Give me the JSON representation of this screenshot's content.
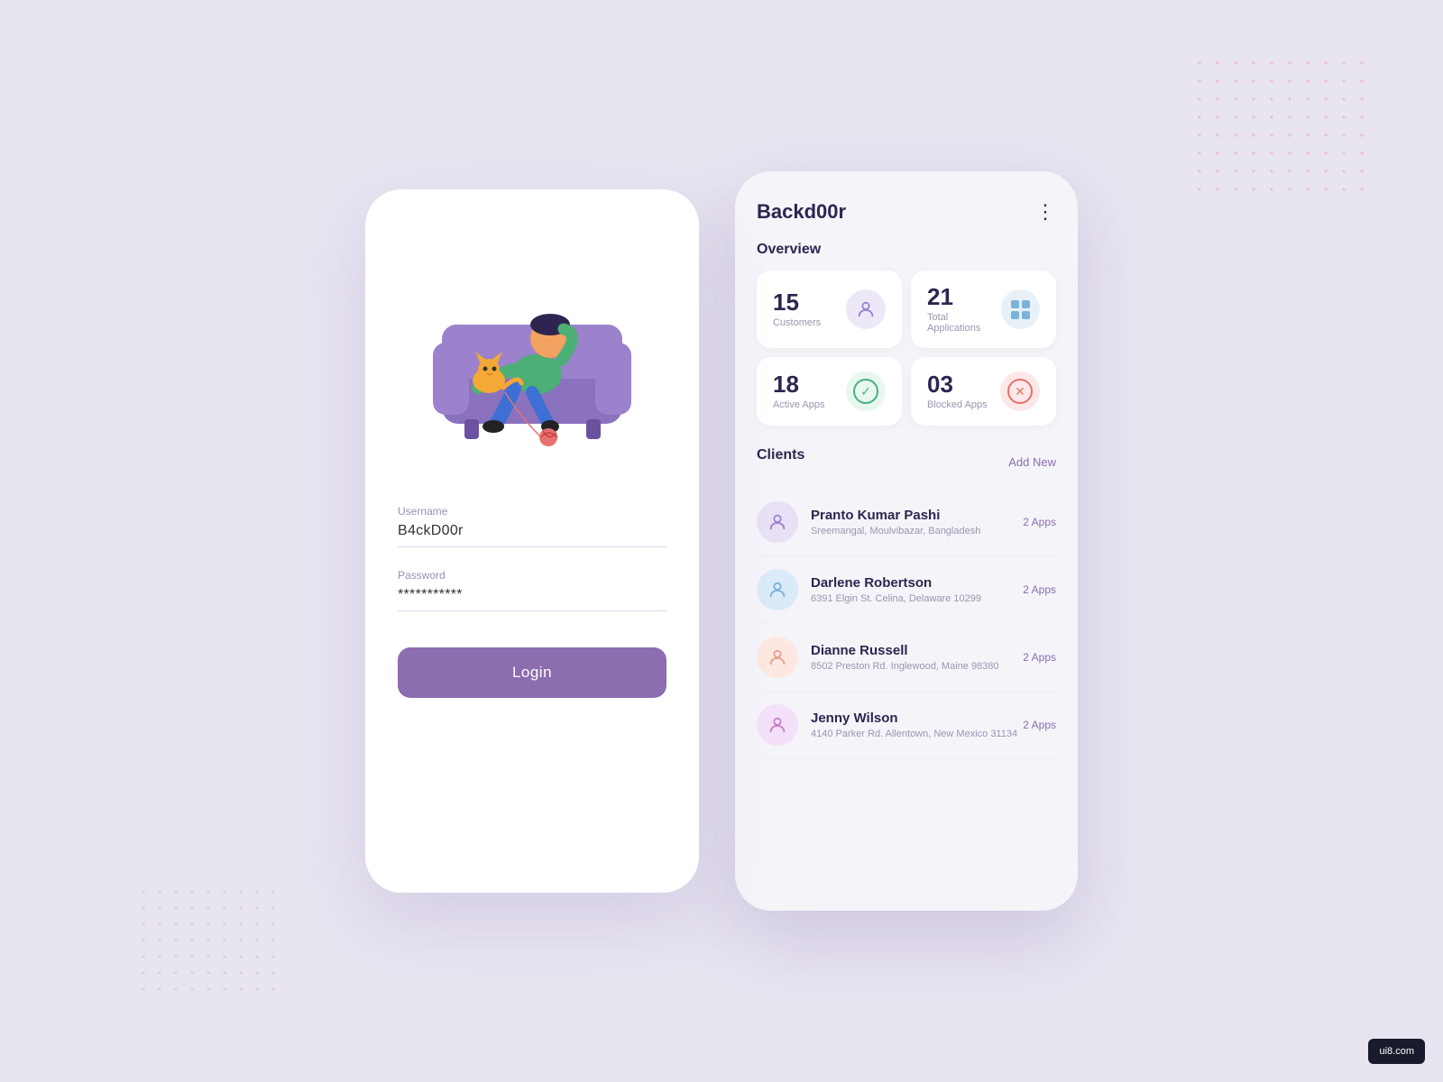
{
  "background": {
    "color": "#e8e4f0"
  },
  "login_screen": {
    "username_label": "Username",
    "username_value": "B4ckD00r",
    "password_label": "Password",
    "password_value": "***********",
    "login_button": "Login"
  },
  "dashboard": {
    "title": "Backd00r",
    "menu_icon": "⋮",
    "overview_title": "Overview",
    "stats": [
      {
        "number": "15",
        "label": "Customers",
        "icon_type": "person",
        "icon_bg": "purple-light"
      },
      {
        "number": "21",
        "label": "Total Applications",
        "icon_type": "grid",
        "icon_bg": "blue-light"
      },
      {
        "number": "18",
        "label": "Active Apps",
        "icon_type": "check",
        "icon_bg": "green-light"
      },
      {
        "number": "03",
        "label": "Blocked Apps",
        "icon_type": "x",
        "icon_bg": "red-light"
      }
    ],
    "clients_title": "Clients",
    "add_new_label": "Add New",
    "clients": [
      {
        "name": "Pranto Kumar Pashi",
        "address": "Sreemangal, Moulvibazar, Bangladesh",
        "apps": "2 Apps",
        "avatar_color": "avatar-purple"
      },
      {
        "name": "Darlene Robertson",
        "address": "6391 Elgin St. Celina, Delaware 10299",
        "apps": "2 Apps",
        "avatar_color": "avatar-blue"
      },
      {
        "name": "Dianne Russell",
        "address": "8502 Preston Rd. Inglewood, Maine 98380",
        "apps": "2 Apps",
        "avatar_color": "avatar-peach"
      },
      {
        "name": "Jenny Wilson",
        "address": "4140 Parker Rd. Allentown, New Mexico 31134",
        "apps": "2 Apps",
        "avatar_color": "avatar-pink"
      }
    ]
  },
  "watermark": {
    "text": "ui8.com"
  }
}
